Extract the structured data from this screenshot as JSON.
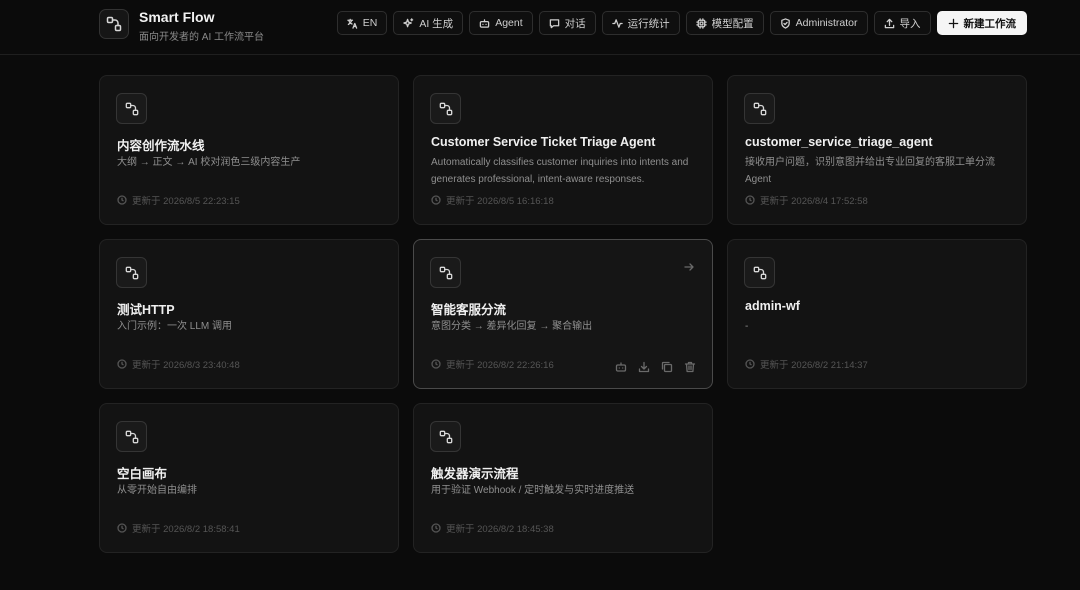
{
  "app": {
    "title": "Smart Flow",
    "subtitle": "面向开发者的 AI 工作流平台"
  },
  "toolbar": {
    "lang": "EN",
    "ai_generate": "AI 生成",
    "agent": "Agent",
    "chat": "对话",
    "stats": "运行统计",
    "model_config": "模型配置",
    "admin": "Administrator",
    "import": "导入",
    "new_workflow": "新建工作流"
  },
  "workflows": [
    {
      "title": "内容创作流水线",
      "desc": "大纲 → 正文 → AI 校对润色三级内容生产",
      "updated": "更新于 2026/8/5 22:23:15"
    },
    {
      "title": "Customer Service Ticket Triage Agent",
      "desc": "Automatically classifies customer inquiries into intents and generates professional, intent-aware responses.",
      "updated": "更新于 2026/8/5 16:16:18"
    },
    {
      "title": "customer_service_triage_agent",
      "desc": "接收用户问题，识别意图并给出专业回复的客服工单分流 Agent",
      "updated": "更新于 2026/8/4 17:52:58"
    },
    {
      "title": "测试HTTP",
      "desc": "入门示例：一次 LLM 调用",
      "updated": "更新于 2026/8/3 23:40:48"
    },
    {
      "title": "智能客服分流",
      "desc": "意图分类 → 差异化回复 → 聚合输出",
      "updated": "更新于 2026/8/2 22:26:16"
    },
    {
      "title": "admin-wf",
      "desc": "-",
      "updated": "更新于 2026/8/2 21:14:37"
    },
    {
      "title": "空白画布",
      "desc": "从零开始自由编排",
      "updated": "更新于 2026/8/2 18:58:41"
    },
    {
      "title": "触发器演示流程",
      "desc": "用于验证 Webhook / 定时触发与实时进度推送",
      "updated": "更新于 2026/8/2 18:45:38"
    }
  ],
  "icons": {
    "logo": "workflow-icon",
    "card": "workflow-icon",
    "time": "clock-icon"
  }
}
